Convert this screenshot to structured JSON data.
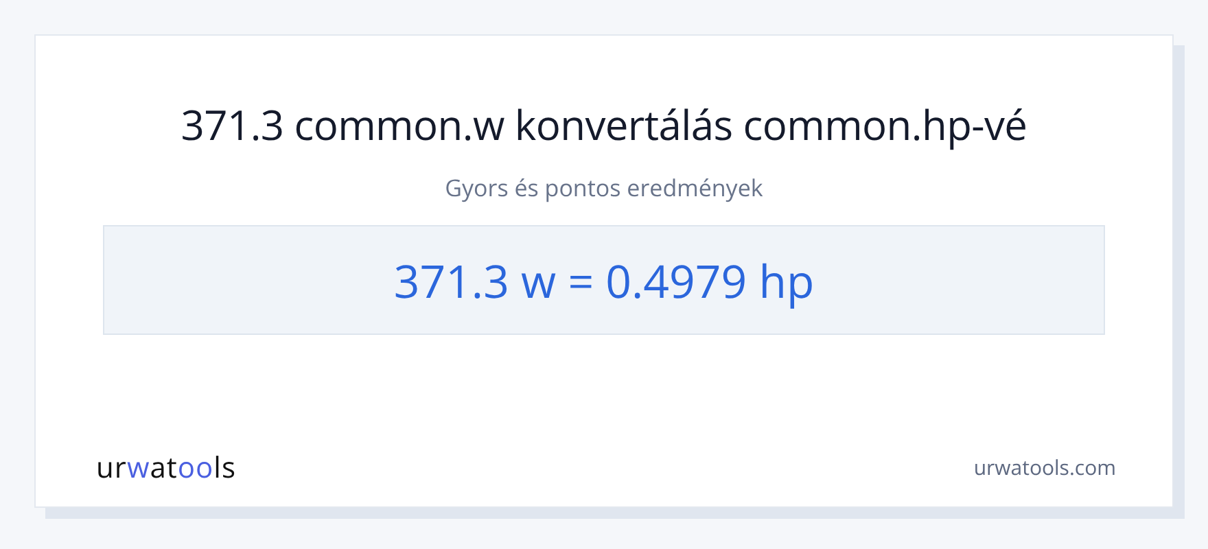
{
  "title": "371.3 common.w konvertálás common.hp-vé",
  "subtitle": "Gyors és pontos eredmények",
  "result": "371.3 w = 0.4979 hp",
  "logo": [
    {
      "text": "ur",
      "accent": false
    },
    {
      "text": "w",
      "accent": true
    },
    {
      "text": "at",
      "accent": false
    },
    {
      "text": "oo",
      "accent": true
    },
    {
      "text": "ls",
      "accent": false
    }
  ],
  "site": "urwatools.com"
}
